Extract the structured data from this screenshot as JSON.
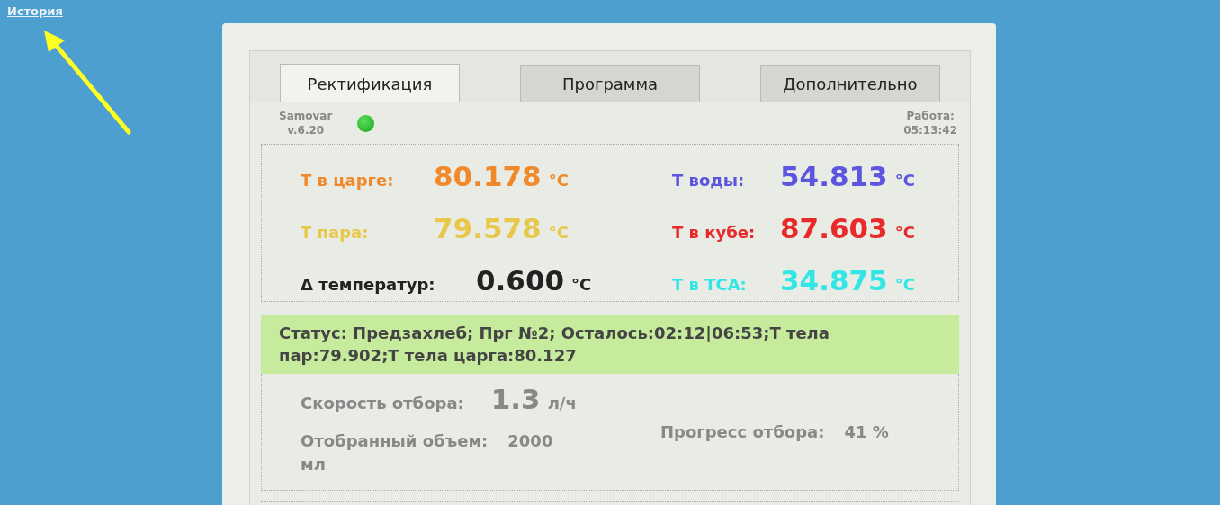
{
  "history_link": "История",
  "tabs": [
    {
      "label": "Ректификация",
      "selected": true
    },
    {
      "label": "Программа",
      "selected": false
    },
    {
      "label": "Дополнительно",
      "selected": false
    }
  ],
  "device": {
    "name": "Samovar",
    "version": "v.6.20",
    "online": true
  },
  "uptime": {
    "label": "Работа:",
    "value": "05:13:42"
  },
  "readings": [
    {
      "label": "Т в царге:",
      "value": "80.178",
      "unit": "°C",
      "color": "#f0892a"
    },
    {
      "label": "Т воды:",
      "value": "54.813",
      "unit": "°C",
      "color": "#5b55e0"
    },
    {
      "label": "Т пара:",
      "value": "79.578",
      "unit": "°C",
      "color": "#e8c84a"
    },
    {
      "label": "Т в кубе:",
      "value": "87.603",
      "unit": "°C",
      "color": "#e82a2a"
    },
    {
      "label": "Δ температур:",
      "value": "0.600",
      "unit": "°C",
      "color": "#222222"
    },
    {
      "label": "Т в ТСА:",
      "value": "34.875",
      "unit": "°C",
      "color": "#33e6e6"
    }
  ],
  "status": "Статус: Предзахлеб; Прг №2; Осталось:02:12|06:53;Т тела пар:79.902;Т тела царга:80.127",
  "speed": {
    "label": "Скорость отбора:",
    "value": "1.3",
    "unit": "л/ч"
  },
  "volume": {
    "label": "Отобранный объем:",
    "value": "2000",
    "unit": "мл"
  },
  "progress": {
    "label": "Прогресс отбора:",
    "value": "41 %"
  }
}
